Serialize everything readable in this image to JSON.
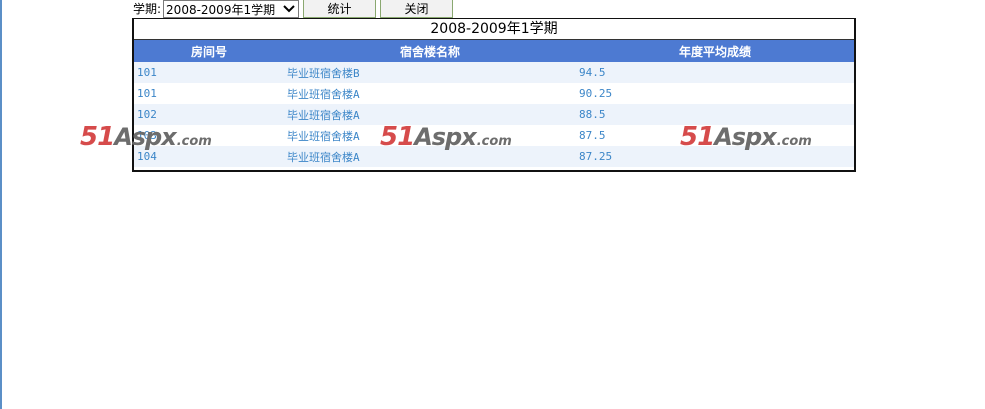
{
  "toolbar": {
    "term_label": "学期:",
    "term_selected": "2008-2009年1学期",
    "stats_button": "统计",
    "close_button": "关闭"
  },
  "panel": {
    "title": "2008-2009年1学期",
    "headers": [
      "房间号",
      "宿舍楼名称",
      "年度平均成绩"
    ],
    "rows": [
      {
        "room": "101",
        "building": "毕业班宿舍楼B",
        "score": "94.5"
      },
      {
        "room": "101",
        "building": "毕业班宿舍楼A",
        "score": "90.25"
      },
      {
        "room": "102",
        "building": "毕业班宿舍楼A",
        "score": "88.5"
      },
      {
        "room": "103",
        "building": "毕业班宿舍楼A",
        "score": "87.5"
      },
      {
        "room": "104",
        "building": "毕业班宿舍楼A",
        "score": "87.25"
      }
    ]
  },
  "watermark": {
    "num": "51",
    "aspx": "Aspx",
    "dotcom": ".com"
  },
  "colors": {
    "header_bg": "#4d7ad2",
    "cell_text": "#3c86c8",
    "alt_row": "#edf3fb",
    "watermark_red": "#d64b4b"
  }
}
